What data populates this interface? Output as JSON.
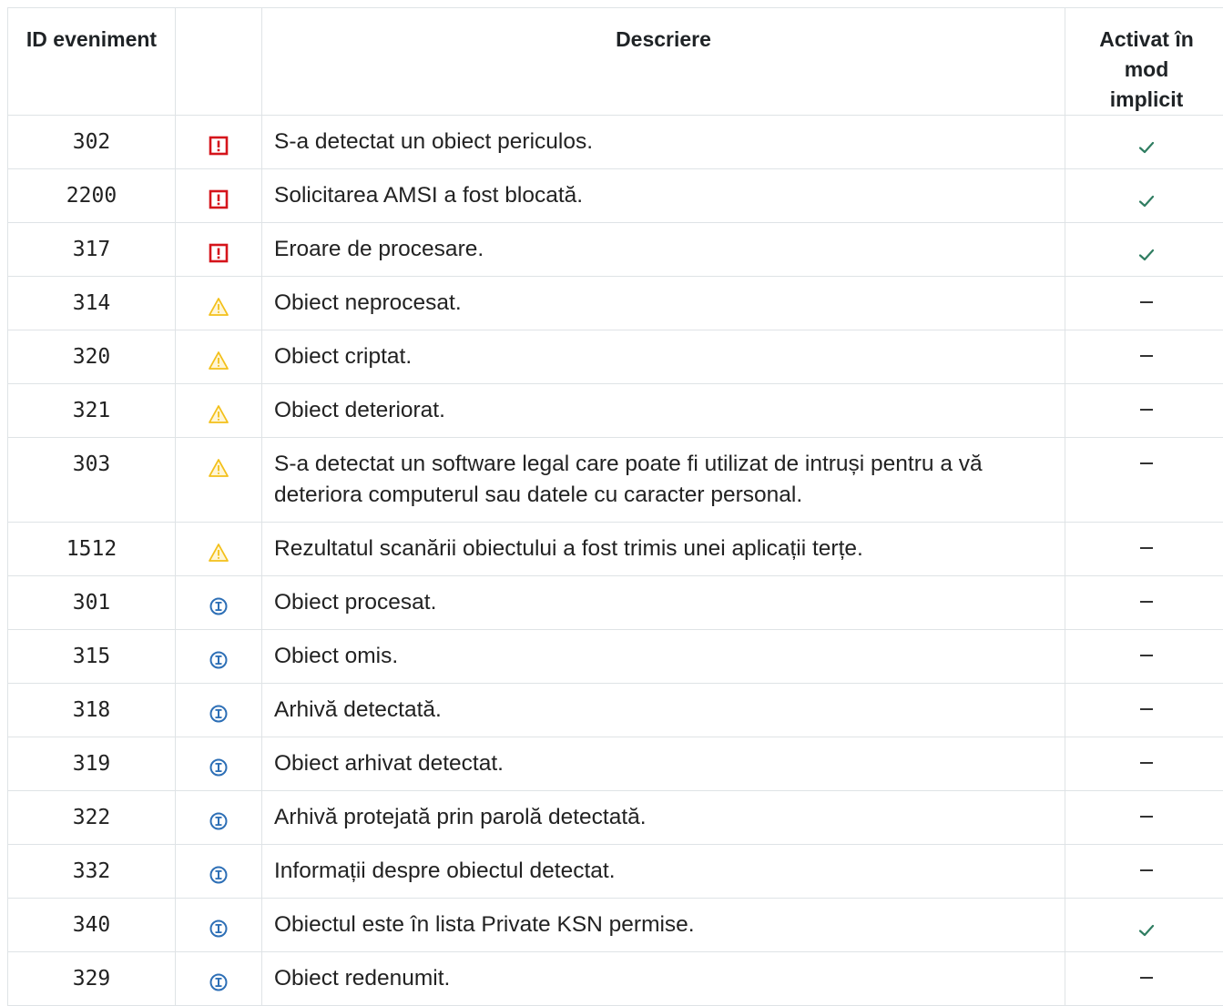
{
  "header": {
    "col_id": "ID eveniment",
    "col_icon": "",
    "col_description": "Descriere",
    "col_default": "Activat în mod implicit"
  },
  "colors": {
    "critical": "#d5141b",
    "warning": "#f3c01a",
    "info": "#2d6fb6",
    "check": "#2f7d61",
    "border": "#dfe3e6"
  },
  "rows": [
    {
      "id": "302",
      "severity": "critical",
      "icon": "critical-icon",
      "description": "S-a detectat un obiect periculos.",
      "default": "check"
    },
    {
      "id": "2200",
      "severity": "critical",
      "icon": "critical-icon",
      "description": "Solicitarea AMSI a fost blocată.",
      "default": "check"
    },
    {
      "id": "317",
      "severity": "critical",
      "icon": "critical-icon",
      "description": "Eroare de procesare.",
      "default": "check"
    },
    {
      "id": "314",
      "severity": "warning",
      "icon": "warning-icon",
      "description": "Obiect neprocesat.",
      "default": "dash"
    },
    {
      "id": "320",
      "severity": "warning",
      "icon": "warning-icon",
      "description": "Obiect criptat.",
      "default": "dash"
    },
    {
      "id": "321",
      "severity": "warning",
      "icon": "warning-icon",
      "description": "Obiect deteriorat.",
      "default": "dash"
    },
    {
      "id": "303",
      "severity": "warning",
      "icon": "warning-icon",
      "description": "S-a detectat un software legal care poate fi utilizat de intruși pentru a vă deteriora computerul sau datele cu caracter personal.",
      "default": "dash"
    },
    {
      "id": "1512",
      "severity": "warning",
      "icon": "warning-icon",
      "description": "Rezultatul scanării obiectului a fost trimis unei aplicații terțe.",
      "default": "dash"
    },
    {
      "id": "301",
      "severity": "info",
      "icon": "info-icon",
      "description": "Obiect procesat.",
      "default": "dash"
    },
    {
      "id": "315",
      "severity": "info",
      "icon": "info-icon",
      "description": "Obiect omis.",
      "default": "dash"
    },
    {
      "id": "318",
      "severity": "info",
      "icon": "info-icon",
      "description": "Arhivă detectată.",
      "default": "dash"
    },
    {
      "id": "319",
      "severity": "info",
      "icon": "info-icon",
      "description": "Obiect arhivat detectat.",
      "default": "dash"
    },
    {
      "id": "322",
      "severity": "info",
      "icon": "info-icon",
      "description": "Arhivă protejată prin parolă detectată.",
      "default": "dash"
    },
    {
      "id": "332",
      "severity": "info",
      "icon": "info-icon",
      "description": "Informații despre obiectul detectat.",
      "default": "dash"
    },
    {
      "id": "340",
      "severity": "info",
      "icon": "info-icon",
      "description": "Obiectul este în lista Private KSN permise.",
      "default": "check"
    },
    {
      "id": "329",
      "severity": "info",
      "icon": "info-icon",
      "description": "Obiect redenumit.",
      "default": "dash"
    }
  ]
}
